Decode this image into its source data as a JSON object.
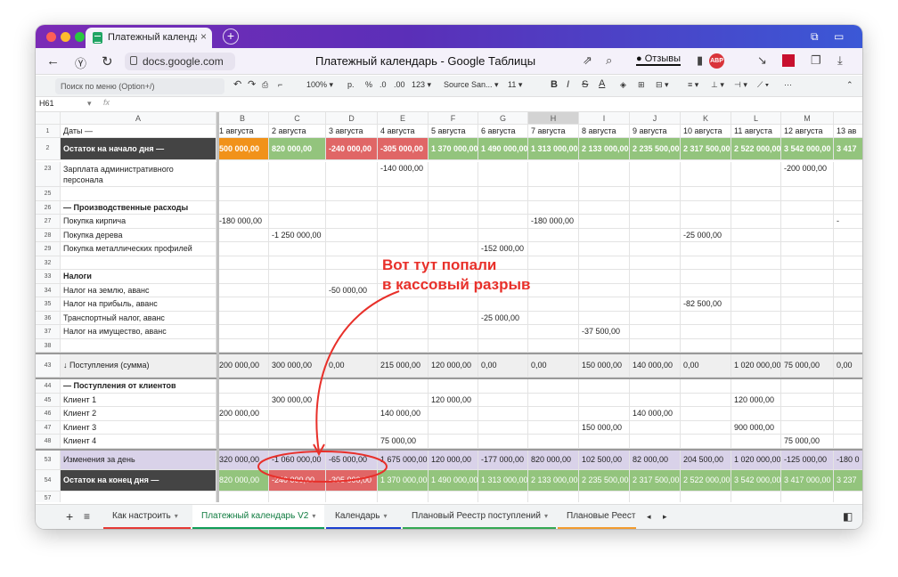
{
  "browser": {
    "tab_title": "Платежный календарь V2",
    "tab_close": "×",
    "new_tab": "+",
    "url": "docs.google.com",
    "page_title": "Платежный календарь - Google Таблицы",
    "reviews_label": "Отзывы",
    "abp_label": "ABP"
  },
  "toolbar": {
    "menu_search": "Поиск по меню (Option+/)",
    "zoom": "100%",
    "currency": "р.",
    "percent": "%",
    "dec_less": ".0",
    "dec_more": ".00",
    "format_123": "123",
    "font": "Source San...",
    "font_size": "11",
    "bold": "B",
    "italic": "I",
    "strike": "S",
    "text_color": "A"
  },
  "formula_bar": {
    "cell_ref": "H61",
    "fx": "fx"
  },
  "columns": [
    "A",
    "B",
    "C",
    "D",
    "E",
    "F",
    "G",
    "H",
    "I",
    "J",
    "K",
    "L",
    "M",
    ""
  ],
  "row1": {
    "num": "1",
    "label": "Даты —",
    "dates": [
      "1 августа",
      "2 августа",
      "3 августа",
      "4 августа",
      "5 августа",
      "6 августа",
      "7 августа",
      "8 августа",
      "9 августа",
      "10 августа",
      "11 августа",
      "12 августа",
      "13 ав"
    ]
  },
  "row2": {
    "num": "2",
    "label": "Остаток на начало дня —",
    "values": [
      "500 000,00",
      "820 000,00",
      "-240 000,00",
      "-305 000,00",
      "1 370 000,00",
      "1 490 000,00",
      "1 313 000,00",
      "2 133 000,00",
      "2 235 500,00",
      "2 317 500,00",
      "2 522 000,00",
      "3 542 000,00",
      "3 417"
    ]
  },
  "rows": [
    {
      "num": "23",
      "label": "Зарплата административного",
      "label2": "персонала",
      "values": [
        "",
        "",
        "",
        "-140 000,00",
        "",
        "",
        "",
        "",
        "",
        "",
        "",
        "-200 000,00",
        ""
      ]
    },
    {
      "num": "25",
      "label": "",
      "values": []
    },
    {
      "num": "26",
      "label": "— Производственные расходы",
      "bold": true,
      "values": []
    },
    {
      "num": "27",
      "label": "Покупка кирпича",
      "values": [
        "-180 000,00",
        "",
        "",
        "",
        "",
        "",
        "-180 000,00",
        "",
        "",
        "",
        "",
        "",
        "-"
      ]
    },
    {
      "num": "28",
      "label": "Покупка дерева",
      "values": [
        "",
        "-1 250 000,00",
        "",
        "",
        "",
        "",
        "",
        "",
        "",
        "-25 000,00",
        "",
        "",
        ""
      ]
    },
    {
      "num": "29",
      "label": "Покупка металлических профилей",
      "values": [
        "",
        "",
        "",
        "",
        "",
        "-152 000,00",
        "",
        "",
        "",
        "",
        "",
        "",
        ""
      ]
    },
    {
      "num": "32",
      "label": "",
      "values": []
    },
    {
      "num": "33",
      "label": "Налоги",
      "bold": true,
      "values": []
    },
    {
      "num": "34",
      "label": "Налог на землю, аванс",
      "values": [
        "",
        "",
        "-50 000,00",
        "",
        "",
        "",
        "",
        "",
        "",
        "",
        "",
        "",
        ""
      ]
    },
    {
      "num": "35",
      "label": "Налог на прибыль, аванс",
      "values": [
        "",
        "",
        "",
        "",
        "",
        "",
        "",
        "",
        "",
        "-82 500,00",
        "",
        "",
        ""
      ]
    },
    {
      "num": "36",
      "label": "Транспортный налог, аванс",
      "values": [
        "",
        "",
        "",
        "",
        "",
        "-25 000,00",
        "",
        "",
        "",
        "",
        "",
        "",
        ""
      ]
    },
    {
      "num": "37",
      "label": "Налог на имущество, аванс",
      "values": [
        "",
        "",
        "",
        "",
        "",
        "",
        "",
        "-37 500,00",
        "",
        "",
        "",
        "",
        ""
      ]
    },
    {
      "num": "38",
      "label": "",
      "values": []
    },
    {
      "num": "43",
      "label": "↓ Поступления (сумма)",
      "grey": true,
      "values": [
        "200 000,00",
        "300 000,00",
        "0,00",
        "215 000,00",
        "120 000,00",
        "0,00",
        "0,00",
        "150 000,00",
        "140 000,00",
        "0,00",
        "1 020 000,00",
        "75 000,00",
        "0,00"
      ]
    },
    {
      "num": "44",
      "label": "— Поступления от клиентов",
      "bold": true,
      "values": []
    },
    {
      "num": "45",
      "label": "Клиент 1",
      "values": [
        "",
        "300 000,00",
        "",
        "",
        "120 000,00",
        "",
        "",
        "",
        "",
        "",
        "120 000,00",
        "",
        ""
      ]
    },
    {
      "num": "46",
      "label": "Клиент 2",
      "values": [
        "200 000,00",
        "",
        "",
        "140 000,00",
        "",
        "",
        "",
        "",
        "140 000,00",
        "",
        "",
        "",
        ""
      ]
    },
    {
      "num": "47",
      "label": "Клиент 3",
      "values": [
        "",
        "",
        "",
        "",
        "",
        "",
        "",
        "150 000,00",
        "",
        "",
        "900 000,00",
        "",
        ""
      ]
    },
    {
      "num": "48",
      "label": "Клиент 4",
      "values": [
        "",
        "",
        "",
        "75 000,00",
        "",
        "",
        "",
        "",
        "",
        "",
        "",
        "75 000,00",
        ""
      ]
    }
  ],
  "row53": {
    "num": "53",
    "label": "Изменения за день",
    "values": [
      "320 000,00",
      "-1 060 000,00",
      "-65 000,00",
      "1 675 000,00",
      "120 000,00",
      "-177 000,00",
      "820 000,00",
      "102 500,00",
      "82 000,00",
      "204 500,00",
      "1 020 000,00",
      "-125 000,00",
      "-180 0"
    ]
  },
  "row54": {
    "num": "54",
    "label": "Остаток на конец дня —",
    "values": [
      "820 000,00",
      "-240 000,00",
      "-305 000,00",
      "1 370 000,00",
      "1 490 000,00",
      "1 313 000,00",
      "2 133 000,00",
      "2 235 500,00",
      "2 317 500,00",
      "2 522 000,00",
      "3 542 000,00",
      "3 417 000,00",
      "3 237"
    ]
  },
  "tail_rows": [
    "57",
    "58"
  ],
  "annotation": {
    "line1": "Вот тут попали",
    "line2": "в кассовый разрыв",
    "color": "#e8302a"
  },
  "sheet_tabs": [
    {
      "label": "Как настроить",
      "color": "#e53935"
    },
    {
      "label": "Платежный календарь V2",
      "color": "#0f9d58",
      "active": true
    },
    {
      "label": "Календарь",
      "color": "#1a3fd0"
    },
    {
      "label": "Плановый Реестр поступлений",
      "color": "#34a853"
    },
    {
      "label": "Плановые Реест",
      "color": "#f29b2e"
    }
  ],
  "colors": {
    "dark": "#444444",
    "green": "#93c47d",
    "orange": "#f1921a",
    "red": "#e06666",
    "violet": "#d9d2e9"
  }
}
